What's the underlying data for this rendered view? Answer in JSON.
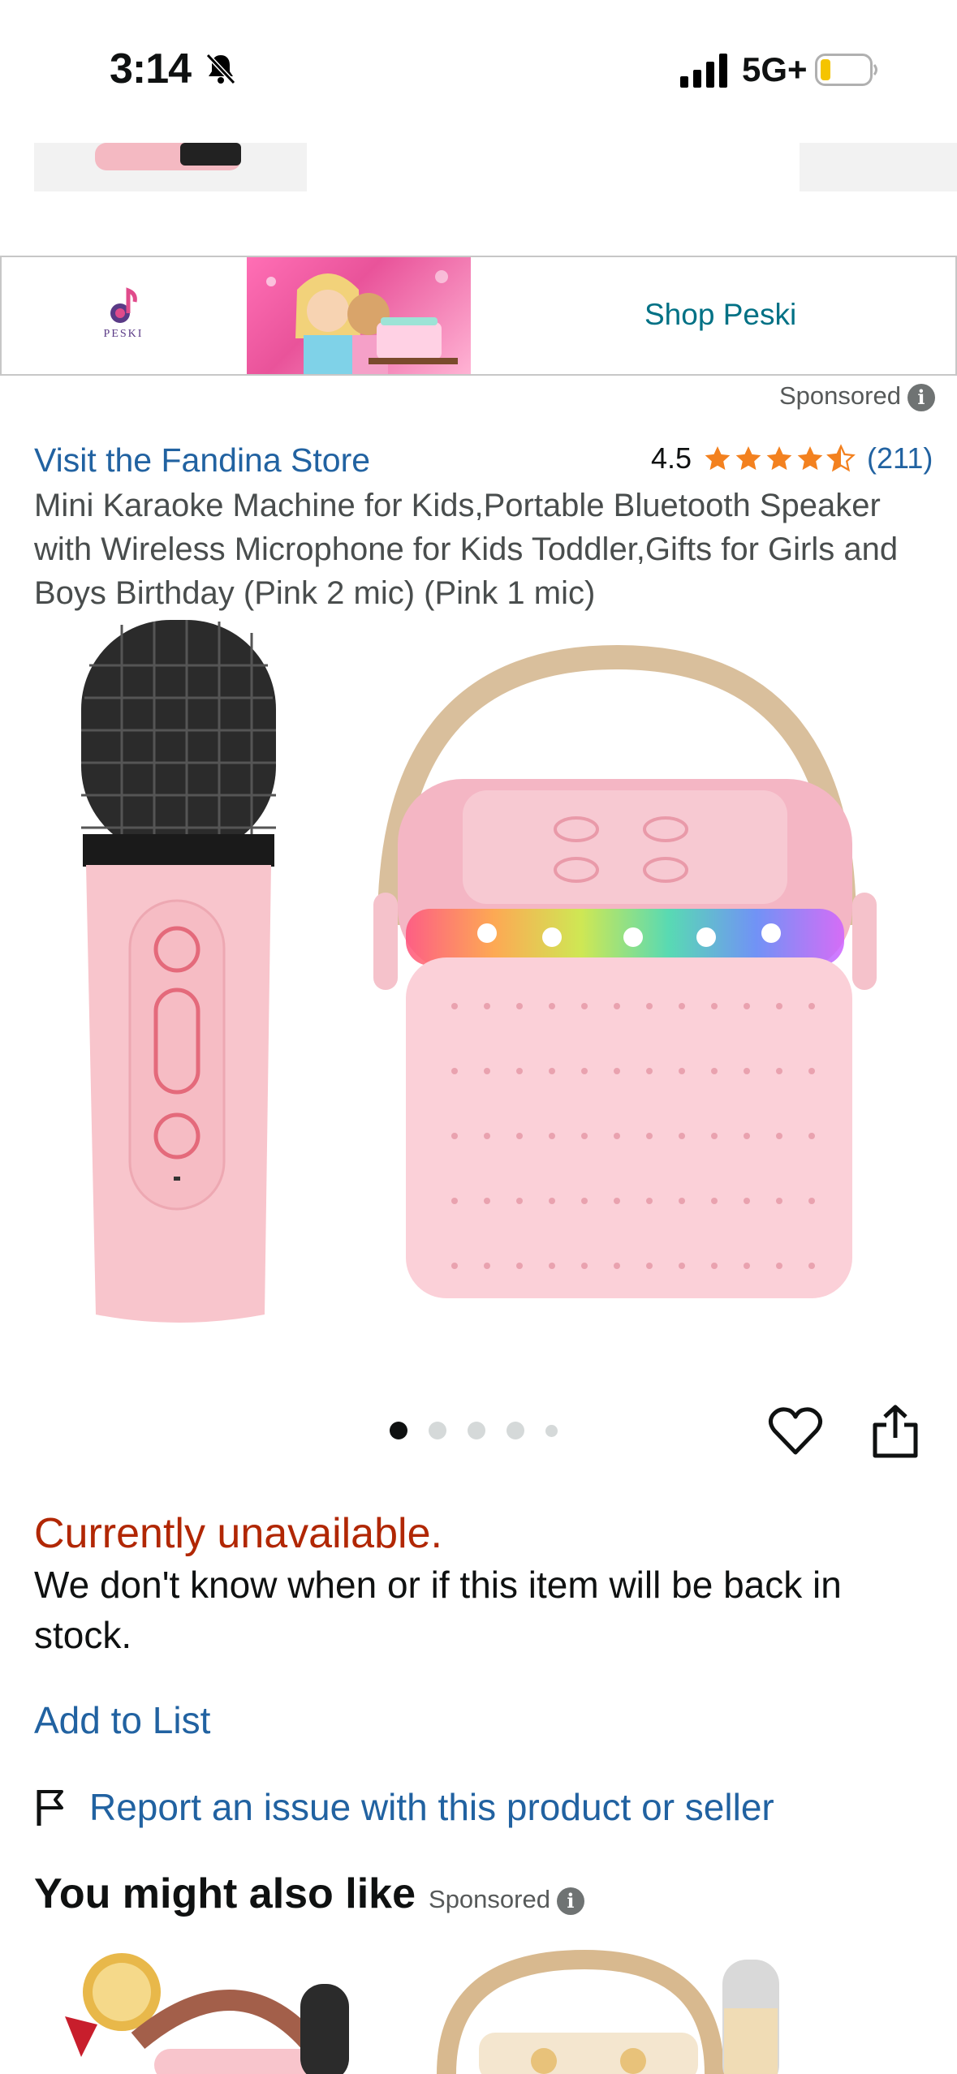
{
  "status_bar": {
    "time": "3:14",
    "network": "5G+",
    "icons": [
      "bell-slash-icon",
      "signal-icon",
      "battery-icon"
    ]
  },
  "ad_banner": {
    "brand_logo_text": "PESKI",
    "link_text": "Shop Peski",
    "sponsored_label": "Sponsored"
  },
  "product": {
    "store_link": "Visit the Fandina Store",
    "rating": "4.5",
    "rating_count": "(211)",
    "stars_filled": 4.5,
    "title": "Mini Karaoke Machine for Kids,Portable Bluetooth Speaker with Wireless Microphone for Kids Toddler,Gifts for Girls and Boys Birthday (Pink 2 mic) (Pink 1 mic)",
    "image_count": 5,
    "active_image_index": 0
  },
  "availability": {
    "status": "Currently unavailable.",
    "message": "We don't know when or if this item will be back in stock."
  },
  "actions": {
    "add_to_list": "Add to List",
    "report": "Report an issue with this product or seller"
  },
  "recommendations": {
    "title": "You might also like",
    "sponsored_label": "Sponsored"
  },
  "colors": {
    "link_blue": "#2162a1",
    "teal_link": "#007185",
    "unavailable_red": "#b12704",
    "star_orange": "#f3811f",
    "product_pink": "#f8c5cc"
  }
}
